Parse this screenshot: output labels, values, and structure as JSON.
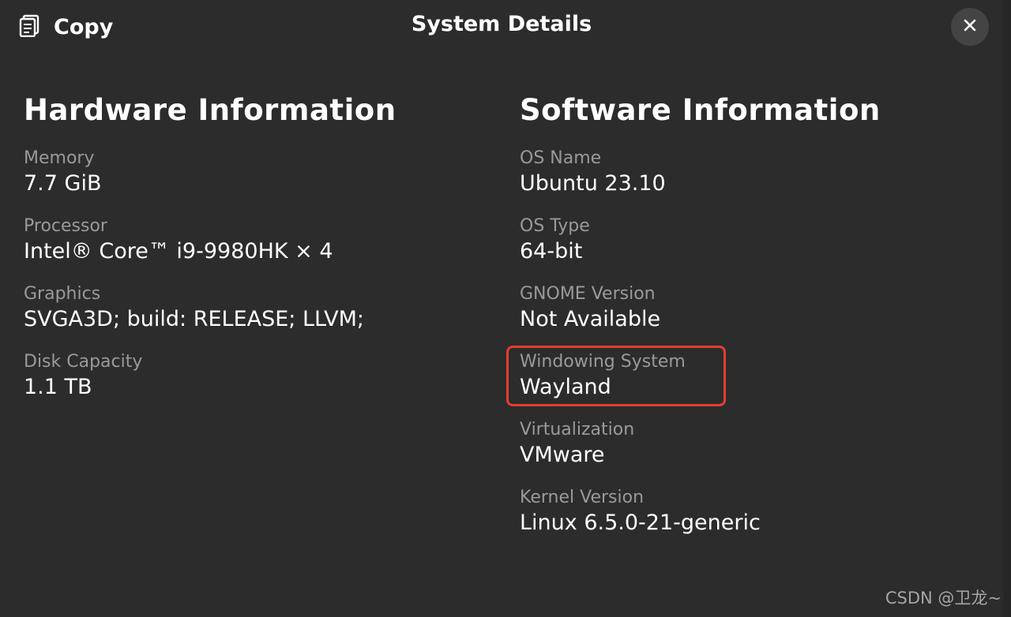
{
  "header": {
    "copy_label": "Copy",
    "title": "System Details",
    "copy_icon": "copy-icon",
    "close_icon": "close-icon"
  },
  "hardware": {
    "title": "Hardware Information",
    "items": [
      {
        "label": "Memory",
        "value": "7.7 GiB"
      },
      {
        "label": "Processor",
        "value": "Intel® Core™ i9-9980HK × 4"
      },
      {
        "label": "Graphics",
        "value": "SVGA3D; build: RELEASE; LLVM;"
      },
      {
        "label": "Disk Capacity",
        "value": "1.1 TB"
      }
    ]
  },
  "software": {
    "title": "Software Information",
    "items": [
      {
        "label": "OS Name",
        "value": "Ubuntu 23.10"
      },
      {
        "label": "OS Type",
        "value": "64-bit"
      },
      {
        "label": "GNOME Version",
        "value": "Not Available"
      },
      {
        "label": "Windowing System",
        "value": "Wayland"
      },
      {
        "label": "Virtualization",
        "value": "VMware"
      },
      {
        "label": "Kernel Version",
        "value": "Linux 6.5.0-21-generic"
      }
    ]
  },
  "annotation": {
    "highlight_color": "#e0402e"
  },
  "watermark": "CSDN @卫龙~"
}
